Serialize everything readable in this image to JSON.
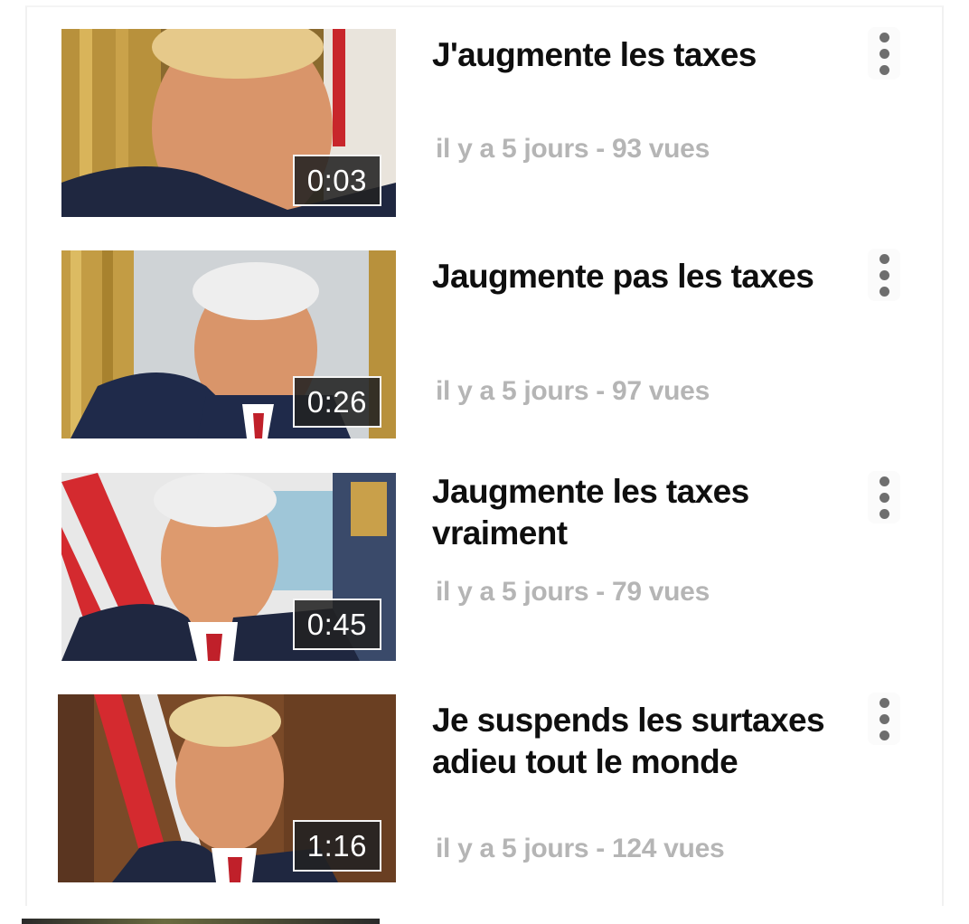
{
  "videos": [
    {
      "title": "J'augmente les taxes",
      "meta": "il y a 5 jours - 93 vues",
      "duration": "0:03",
      "menu_icon": "more-vert-icon"
    },
    {
      "title": "Jaugmente pas les taxes",
      "meta": "il y a 5 jours - 97 vues",
      "duration": "0:26",
      "menu_icon": "more-vert-icon"
    },
    {
      "title": "Jaugmente les taxes vraiment",
      "meta": "il y a 5 jours - 79 vues",
      "duration": "0:45",
      "menu_icon": "more-vert-icon"
    },
    {
      "title": "Je suspends les surtaxes adieu tout le monde",
      "meta": "il y a 5 jours - 124 vues",
      "duration": "1:16",
      "menu_icon": "more-vert-icon"
    }
  ],
  "colors": {
    "title": "#0f0f0f",
    "meta": "#b5b5b5",
    "duration_bg": "#222222",
    "menu_dots": "#6e6e6e"
  }
}
